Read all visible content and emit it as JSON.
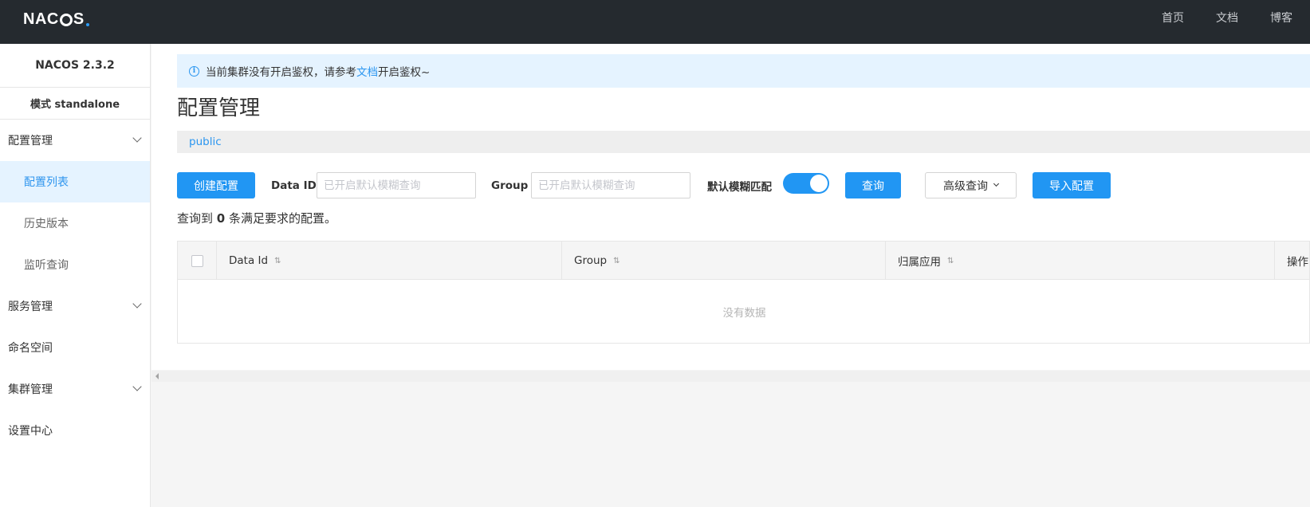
{
  "topbar": {
    "logo": {
      "part1": "NAC",
      "part2": "S"
    },
    "nav": [
      {
        "label": "首页"
      },
      {
        "label": "文档"
      },
      {
        "label": "博客"
      }
    ]
  },
  "sidebar": {
    "version": "NACOS 2.3.2",
    "mode": "模式 standalone",
    "items": [
      {
        "label": "配置管理"
      },
      {
        "label": "配置列表"
      },
      {
        "label": "历史版本"
      },
      {
        "label": "监听查询"
      },
      {
        "label": "服务管理"
      },
      {
        "label": "命名空间"
      },
      {
        "label": "集群管理"
      },
      {
        "label": "设置中心"
      }
    ]
  },
  "notice": {
    "prefix": "当前集群没有开启鉴权，请参考",
    "link": "文档",
    "suffix": "开启鉴权~"
  },
  "page": {
    "title": "配置管理"
  },
  "namespace": {
    "label": "public"
  },
  "toolbar": {
    "create_label": "创建配置",
    "dataid_label": "Data ID",
    "dataid_placeholder": "已开启默认模糊查询",
    "group_label": "Group",
    "group_placeholder": "已开启默认模糊查询",
    "fuzzy_label": "默认模糊匹配",
    "fuzzy_on": true,
    "query_label": "查询",
    "advanced_label": "高级查询",
    "import_label": "导入配置"
  },
  "result": {
    "prefix": "查询到",
    "count": "0",
    "suffix": "条满足要求的配置。"
  },
  "table": {
    "columns": [
      "Data Id",
      "Group",
      "归属应用",
      "操作"
    ],
    "sort_icon": "⇅",
    "empty_text": "没有数据"
  },
  "colors": {
    "primary": "#2196f3",
    "topbar": "#252a2f",
    "active_bg": "#e5f3ff"
  }
}
